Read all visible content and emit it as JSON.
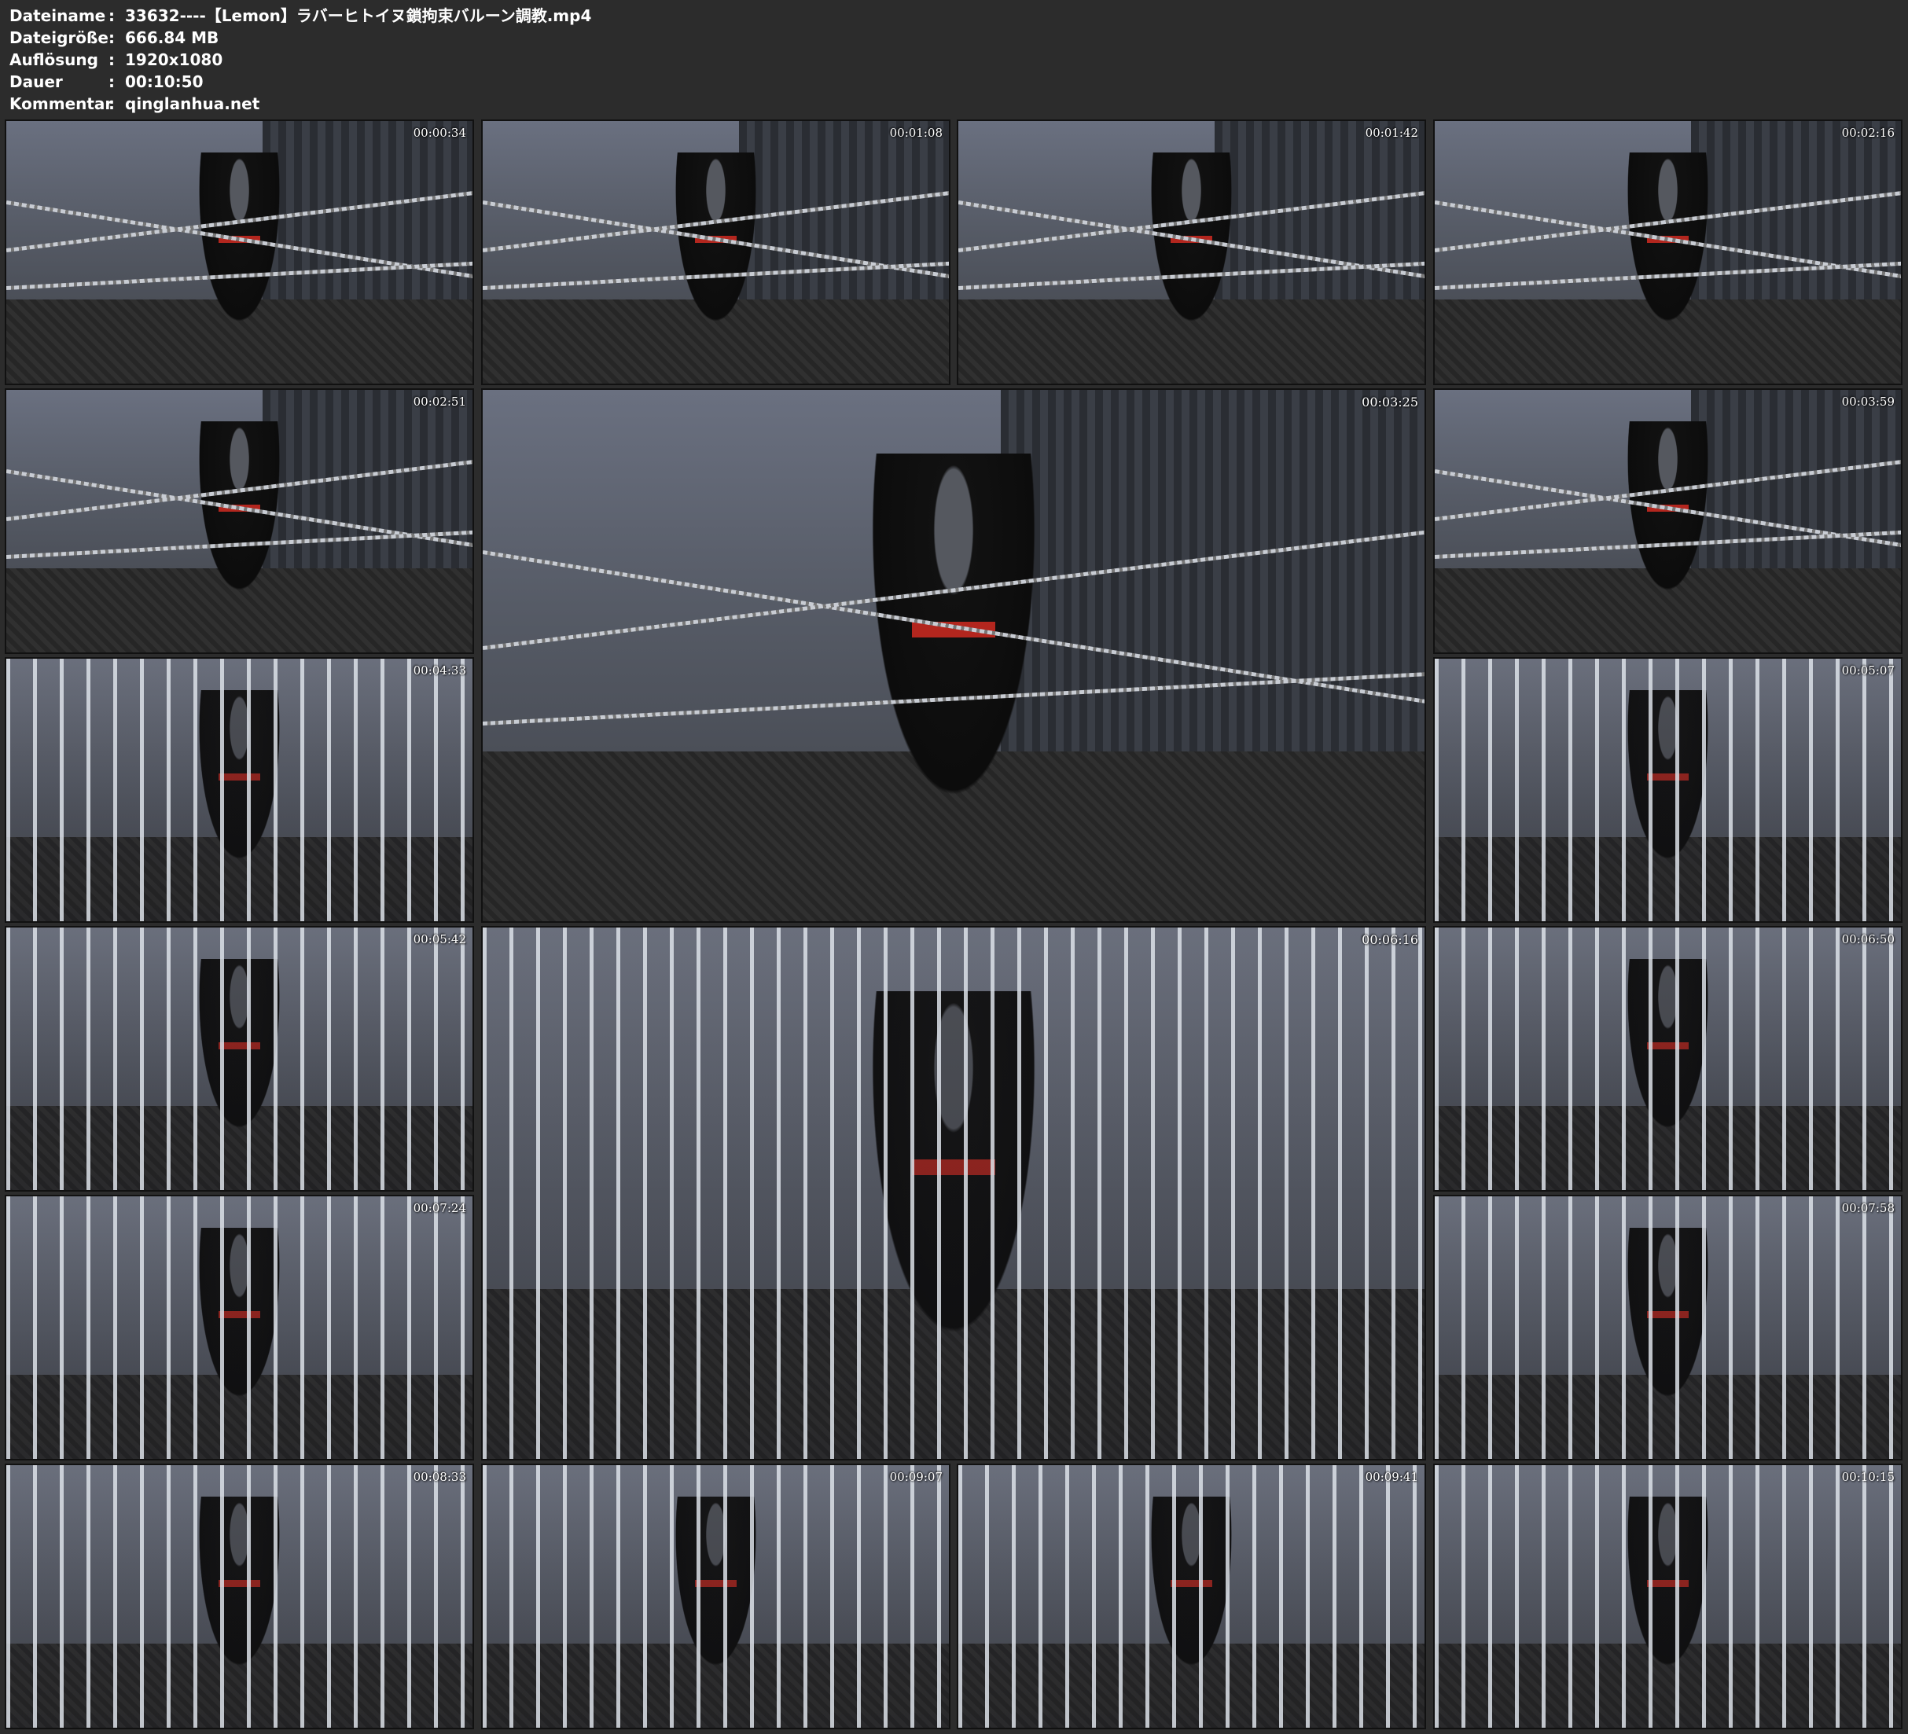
{
  "meta": {
    "rows": [
      {
        "key": "Dateiname",
        "sep": ":",
        "value": "33632----【Lemon】ラバーヒトイヌ鎖拘束バルーン調教.mp4"
      },
      {
        "key": "Dateigröße",
        "sep": ":",
        "value": "666.84 MB"
      },
      {
        "key": "Auflösung",
        "sep": ":",
        "value": "1920x1080"
      },
      {
        "key": "Dauer",
        "sep": ":",
        "value": "00:10:50"
      },
      {
        "key": "Kommentar",
        "sep": ":",
        "value": "qinglanhua.net"
      }
    ]
  },
  "thumbnails": [
    {
      "timestamp": "00:00:34",
      "scene": "chains"
    },
    {
      "timestamp": "00:01:08",
      "scene": "chains"
    },
    {
      "timestamp": "00:01:42",
      "scene": "chains"
    },
    {
      "timestamp": "00:02:16",
      "scene": "chains"
    },
    {
      "timestamp": "00:02:51",
      "scene": "chains"
    },
    {
      "timestamp": "00:03:25",
      "scene": "chains"
    },
    {
      "timestamp": "00:03:59",
      "scene": "chains"
    },
    {
      "timestamp": "00:04:33",
      "scene": "cage"
    },
    {
      "timestamp": "00:05:07",
      "scene": "cage"
    },
    {
      "timestamp": "00:05:42",
      "scene": "cage"
    },
    {
      "timestamp": "00:06:16",
      "scene": "cage"
    },
    {
      "timestamp": "00:06:50",
      "scene": "cage"
    },
    {
      "timestamp": "00:07:24",
      "scene": "cage"
    },
    {
      "timestamp": "00:07:58",
      "scene": "cage"
    },
    {
      "timestamp": "00:08:33",
      "scene": "cage"
    },
    {
      "timestamp": "00:09:07",
      "scene": "cage"
    },
    {
      "timestamp": "00:09:41",
      "scene": "cage"
    },
    {
      "timestamp": "00:10:15",
      "scene": "cage"
    }
  ]
}
